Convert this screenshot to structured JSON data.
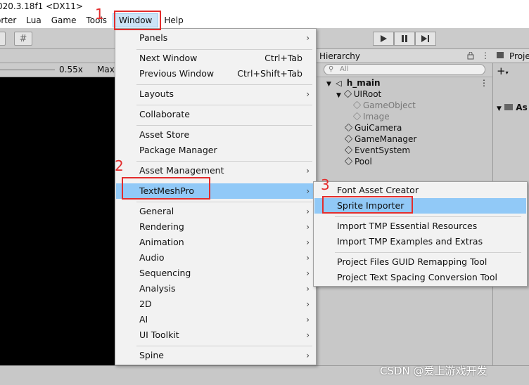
{
  "window_title": "020.3.18f1 <DX11>",
  "menubar": {
    "items": [
      "orter",
      "Lua",
      "Game",
      "Tools",
      "Window",
      "Help"
    ],
    "active": "Window"
  },
  "toolbar": {
    "grid_icon": "#"
  },
  "game_view": {
    "scale_value": "0.55x",
    "maximize_label": "Max"
  },
  "hierarchy": {
    "tab_label": "Hierarchy",
    "search_placeholder": "All",
    "scene_name": "h_main",
    "rows": [
      {
        "label": "UIRoot"
      },
      {
        "label": "GameObject"
      },
      {
        "label": "Image"
      },
      {
        "label": "GuiCamera"
      },
      {
        "label": "GameManager"
      },
      {
        "label": "EventSystem"
      },
      {
        "label": "Pool"
      }
    ]
  },
  "project": {
    "tab_label": "Proje",
    "assets_label": "As"
  },
  "window_menu": {
    "items": [
      {
        "label": "Panels",
        "shortcut": "",
        "submenu": true
      },
      {
        "label": "Next Window",
        "shortcut": "Ctrl+Tab",
        "submenu": false
      },
      {
        "label": "Previous Window",
        "shortcut": "Ctrl+Shift+Tab",
        "submenu": false
      },
      {
        "label": "Layouts",
        "shortcut": "",
        "submenu": true
      },
      {
        "label": "Collaborate",
        "shortcut": "",
        "submenu": false
      },
      {
        "label": "Asset Store",
        "shortcut": "",
        "submenu": false
      },
      {
        "label": "Package Manager",
        "shortcut": "",
        "submenu": false
      },
      {
        "label": "Asset Management",
        "shortcut": "",
        "submenu": true
      },
      {
        "label": "TextMeshPro",
        "shortcut": "",
        "submenu": true,
        "highlighted": true
      },
      {
        "label": "General",
        "shortcut": "",
        "submenu": true
      },
      {
        "label": "Rendering",
        "shortcut": "",
        "submenu": true
      },
      {
        "label": "Animation",
        "shortcut": "",
        "submenu": true
      },
      {
        "label": "Audio",
        "shortcut": "",
        "submenu": true
      },
      {
        "label": "Sequencing",
        "shortcut": "",
        "submenu": true
      },
      {
        "label": "Analysis",
        "shortcut": "",
        "submenu": true
      },
      {
        "label": "2D",
        "shortcut": "",
        "submenu": true
      },
      {
        "label": "AI",
        "shortcut": "",
        "submenu": true
      },
      {
        "label": "UI Toolkit",
        "shortcut": "",
        "submenu": true
      },
      {
        "label": "Spine",
        "shortcut": "",
        "submenu": true
      }
    ]
  },
  "textmeshpro_menu": {
    "items": [
      {
        "label": "Font Asset Creator"
      },
      {
        "label": "Sprite Importer",
        "highlighted": true
      },
      {
        "label": "Import TMP Essential Resources"
      },
      {
        "label": "Import TMP Examples and Extras"
      },
      {
        "label": "Project Files GUID Remapping Tool"
      },
      {
        "label": "Project Text Spacing Conversion Tool"
      }
    ]
  },
  "annotations": {
    "step1": "1",
    "step2": "2",
    "step3": "3",
    "color": "#e32d2d"
  },
  "watermark": "CSDN @爱上游戏开发",
  "colors": {
    "menu_highlight": "#91c9f7",
    "menubar_active": "#cce4f7",
    "menu_background": "#f2f2f2",
    "editor_background": "#c8c8c8"
  }
}
